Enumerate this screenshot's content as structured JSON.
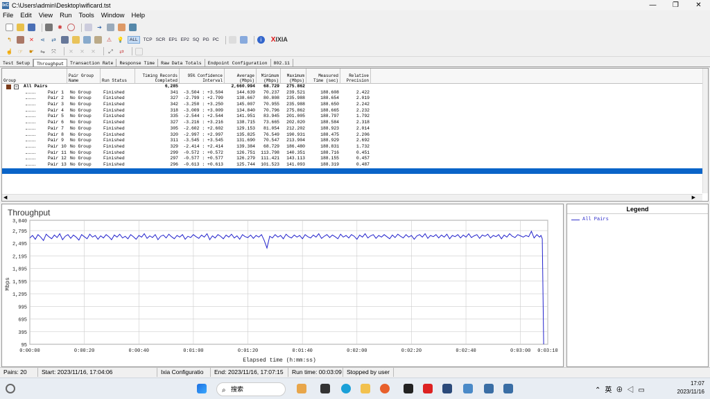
{
  "window": {
    "title": "C:\\Users\\admin\\Desktop\\wificard.tst",
    "app_icon": "IxC",
    "minimize": "—",
    "maximize": "❐",
    "close": "✕"
  },
  "menu": [
    "File",
    "Edit",
    "View",
    "Run",
    "Tools",
    "Window",
    "Help"
  ],
  "toolbar": {
    "filters": [
      "ALL",
      "TCP",
      "SCR",
      "EP1",
      "EP2",
      "SQ",
      "PG",
      "PC"
    ],
    "active_filter": "ALL",
    "brand": "IXIA",
    "brand_x": "X"
  },
  "tabs": [
    "Test Setup",
    "Throughput",
    "Transaction Rate",
    "Response Time",
    "Raw Data Totals",
    "Endpoint Configuration",
    "802.11"
  ],
  "active_tab": "Throughput",
  "table": {
    "headers": {
      "group": "Group",
      "pg1": "Pair Group",
      "pg2": "Name",
      "rs": "Run Status",
      "tr1": "Timing Records",
      "tr2": "Completed",
      "ci1": "95% Confidence",
      "ci2": "Interval",
      "avg1": "Average",
      "avg2": "(Mbps)",
      "min1": "Minimum",
      "min2": "(Mbps)",
      "max1": "Maximum",
      "max2": "(Mbps)",
      "mt1": "Measured",
      "mt2": "Time (sec)",
      "rp1": "Relative",
      "rp2": "Precision"
    },
    "summary": {
      "label": "All Pairs",
      "records": "6,285",
      "average": "2,660.994",
      "minimum": "68.729",
      "maximum": "275.862"
    },
    "rows": [
      {
        "pair": "Pair 1",
        "group": "No Group",
        "status": "Finished",
        "records": "341",
        "ci": "-3.504 : +3.504",
        "avg": "144.639",
        "min": "70.237",
        "max": "239.521",
        "time": "188.608",
        "rp": "2.422"
      },
      {
        "pair": "Pair 2",
        "group": "No Group",
        "status": "Finished",
        "records": "327",
        "ci": "-2.799 : +2.799",
        "avg": "138.667",
        "min": "80.808",
        "max": "235.988",
        "time": "188.654",
        "rp": "2.019"
      },
      {
        "pair": "Pair 3",
        "group": "No Group",
        "status": "Finished",
        "records": "342",
        "ci": "-3.250 : +3.250",
        "avg": "145.007",
        "min": "70.955",
        "max": "235.988",
        "time": "188.650",
        "rp": "2.242"
      },
      {
        "pair": "Pair 4",
        "group": "No Group",
        "status": "Finished",
        "records": "318",
        "ci": "-3.009 : +3.009",
        "avg": "134.840",
        "min": "70.796",
        "max": "275.862",
        "time": "188.665",
        "rp": "2.232"
      },
      {
        "pair": "Pair 5",
        "group": "No Group",
        "status": "Finished",
        "records": "335",
        "ci": "-2.544 : +2.544",
        "avg": "141.951",
        "min": "83.945",
        "max": "201.005",
        "time": "188.797",
        "rp": "1.792"
      },
      {
        "pair": "Pair 6",
        "group": "No Group",
        "status": "Finished",
        "records": "327",
        "ci": "-3.216 : +3.216",
        "avg": "138.715",
        "min": "73.665",
        "max": "202.020",
        "time": "188.584",
        "rp": "2.318"
      },
      {
        "pair": "Pair 7",
        "group": "No Group",
        "status": "Finished",
        "records": "305",
        "ci": "-2.602 : +2.602",
        "avg": "129.153",
        "min": "81.054",
        "max": "212.202",
        "time": "188.923",
        "rp": "2.014"
      },
      {
        "pair": "Pair 8",
        "group": "No Group",
        "status": "Finished",
        "records": "320",
        "ci": "-2.997 : +2.997",
        "avg": "135.825",
        "min": "76.549",
        "max": "190.931",
        "time": "188.475",
        "rp": "2.206"
      },
      {
        "pair": "Pair 9",
        "group": "No Group",
        "status": "Finished",
        "records": "311",
        "ci": "-3.545 : +3.545",
        "avg": "131.690",
        "min": "70.547",
        "max": "213.904",
        "time": "188.929",
        "rp": "2.692"
      },
      {
        "pair": "Pair 10",
        "group": "No Group",
        "status": "Finished",
        "records": "329",
        "ci": "-2.414 : +2.414",
        "avg": "139.384",
        "min": "68.729",
        "max": "186.480",
        "time": "188.831",
        "rp": "1.732"
      },
      {
        "pair": "Pair 11",
        "group": "No Group",
        "status": "Finished",
        "records": "299",
        "ci": "-0.572 : +0.572",
        "avg": "126.751",
        "min": "113.798",
        "max": "140.351",
        "time": "188.716",
        "rp": "0.451"
      },
      {
        "pair": "Pair 12",
        "group": "No Group",
        "status": "Finished",
        "records": "297",
        "ci": "-0.577 : +0.577",
        "avg": "126.279",
        "min": "111.421",
        "max": "143.113",
        "time": "188.155",
        "rp": "0.457"
      },
      {
        "pair": "Pair 13",
        "group": "No Group",
        "status": "Finished",
        "records": "296",
        "ci": "-0.613 : +0.613",
        "avg": "125.744",
        "min": "101.523",
        "max": "141.093",
        "time": "188.319",
        "rp": "0.487"
      }
    ]
  },
  "chart_data": {
    "type": "line",
    "title": "Throughput",
    "xlabel": "Elapsed time (h:mm:ss)",
    "ylabel": "Mbps",
    "ylim": [
      95,
      3040
    ],
    "y_ticks": [
      "3,040",
      "2,795",
      "2,495",
      "2,195",
      "1,895",
      "1,595",
      "1,295",
      "995",
      "695",
      "395",
      "95"
    ],
    "y_tick_values": [
      3040,
      2795,
      2495,
      2195,
      1895,
      1595,
      1295,
      995,
      695,
      395,
      95
    ],
    "x_ticks": [
      "0:00:00",
      "0:00:20",
      "0:00:40",
      "0:01:00",
      "0:01:20",
      "0:01:40",
      "0:02:00",
      "0:02:20",
      "0:02:40",
      "0:03:00",
      "0:03:10"
    ],
    "x_tick_seconds": [
      0,
      20,
      40,
      60,
      80,
      100,
      120,
      140,
      160,
      180,
      190
    ],
    "xlim": [
      0,
      190
    ],
    "grid": true,
    "series": [
      {
        "name": "All Pairs",
        "color": "#2222cc",
        "x": [
          0,
          1,
          2,
          3,
          4,
          5,
          6,
          7,
          8,
          9,
          10,
          11,
          12,
          13,
          14,
          15,
          16,
          17,
          18,
          19,
          20,
          21,
          22,
          23,
          24,
          25,
          26,
          27,
          28,
          29,
          30,
          31,
          32,
          33,
          34,
          35,
          36,
          37,
          38,
          39,
          40,
          41,
          42,
          43,
          44,
          45,
          46,
          47,
          48,
          49,
          50,
          51,
          52,
          53,
          54,
          55,
          56,
          57,
          58,
          59,
          60,
          61,
          62,
          63,
          64,
          65,
          66,
          67,
          68,
          69,
          70,
          71,
          72,
          73,
          74,
          75,
          76,
          77,
          78,
          79,
          80,
          81,
          82,
          83,
          84,
          85,
          86,
          87,
          88,
          89,
          90,
          91,
          92,
          93,
          94,
          95,
          96,
          97,
          98,
          99,
          100,
          101,
          102,
          103,
          104,
          105,
          106,
          107,
          108,
          109,
          110,
          111,
          112,
          113,
          114,
          115,
          116,
          117,
          118,
          119,
          120,
          121,
          122,
          123,
          124,
          125,
          126,
          127,
          128,
          129,
          130,
          131,
          132,
          133,
          134,
          135,
          136,
          137,
          138,
          139,
          140,
          141,
          142,
          143,
          144,
          145,
          146,
          147,
          148,
          149,
          150,
          151,
          152,
          153,
          154,
          155,
          156,
          157,
          158,
          159,
          160,
          161,
          162,
          163,
          164,
          165,
          166,
          167,
          168,
          169,
          170,
          171,
          172,
          173,
          174,
          175,
          176,
          177,
          178,
          179,
          180,
          181,
          182,
          183,
          184,
          185,
          186,
          187,
          187.5,
          188,
          188.5
        ],
        "y": [
          2620,
          2680,
          2590,
          2700,
          2640,
          2560,
          2710,
          2650,
          2600,
          2690,
          2630,
          2720,
          2580,
          2660,
          2700,
          2610,
          2690,
          2640,
          2570,
          2700,
          2650,
          2600,
          2710,
          2640,
          2680,
          2590,
          2670,
          2620,
          2700,
          2650,
          2580,
          2690,
          2640,
          2710,
          2620,
          2660,
          2600,
          2700,
          2650,
          2590,
          2680,
          2640,
          2720,
          2610,
          2670,
          2630,
          2700,
          2580,
          2660,
          2690,
          2620,
          2710,
          2650,
          2600,
          2680,
          2640,
          2700,
          2590,
          2660,
          2630,
          2700,
          2650,
          2610,
          2690,
          2640,
          2720,
          2580,
          2670,
          2620,
          2700,
          2660,
          2600,
          2690,
          2640,
          2710,
          2620,
          2670,
          2590,
          2700,
          2650,
          2630,
          2690,
          2610,
          2680,
          2640,
          2700,
          2560,
          2380,
          2660,
          2620,
          2700,
          2640,
          2680,
          2600,
          2710,
          2650,
          2620,
          2690,
          2640,
          2680,
          2600,
          2700,
          2650,
          2620,
          2690,
          2640,
          2720,
          2610,
          2660,
          2700,
          2630,
          2690,
          2650,
          2600,
          2710,
          2640,
          2680,
          2620,
          2700,
          2660,
          2590,
          2690,
          2640,
          2720,
          2620,
          2670,
          2700,
          2610,
          2680,
          2640,
          2700,
          2650,
          2600,
          2690,
          2630,
          2710,
          2660,
          2620,
          2700,
          2640,
          2680,
          2590,
          2670,
          2700,
          2640,
          2720,
          2610,
          2680,
          2650,
          2700,
          2620,
          2690,
          2640,
          2710,
          2600,
          2680,
          2650,
          2700,
          2620,
          2690,
          2640,
          2720,
          2630,
          2670,
          2700,
          2610,
          2690,
          2660,
          2710,
          2620,
          2680,
          2650,
          2700,
          2600,
          2690,
          2640,
          2720,
          2660,
          2630,
          2700,
          2670,
          2640,
          2680,
          2650,
          2780,
          2620,
          2700,
          2640,
          2680,
          2600,
          95
        ]
      }
    ]
  },
  "legend": {
    "title": "Legend",
    "items": [
      "All Pairs"
    ]
  },
  "status": {
    "pairs": "Pairs: 20",
    "start": "Start: 2023/11/16, 17:04:06",
    "config": "Ixia Configuratio",
    "end": "End: 2023/11/16, 17:07:15",
    "runtime": "Run time: 00:03:09",
    "stopped": "Stopped by user"
  },
  "taskbar": {
    "search": "搜索",
    "time": "17:07",
    "date": "2023/11/16",
    "ime": "英"
  }
}
